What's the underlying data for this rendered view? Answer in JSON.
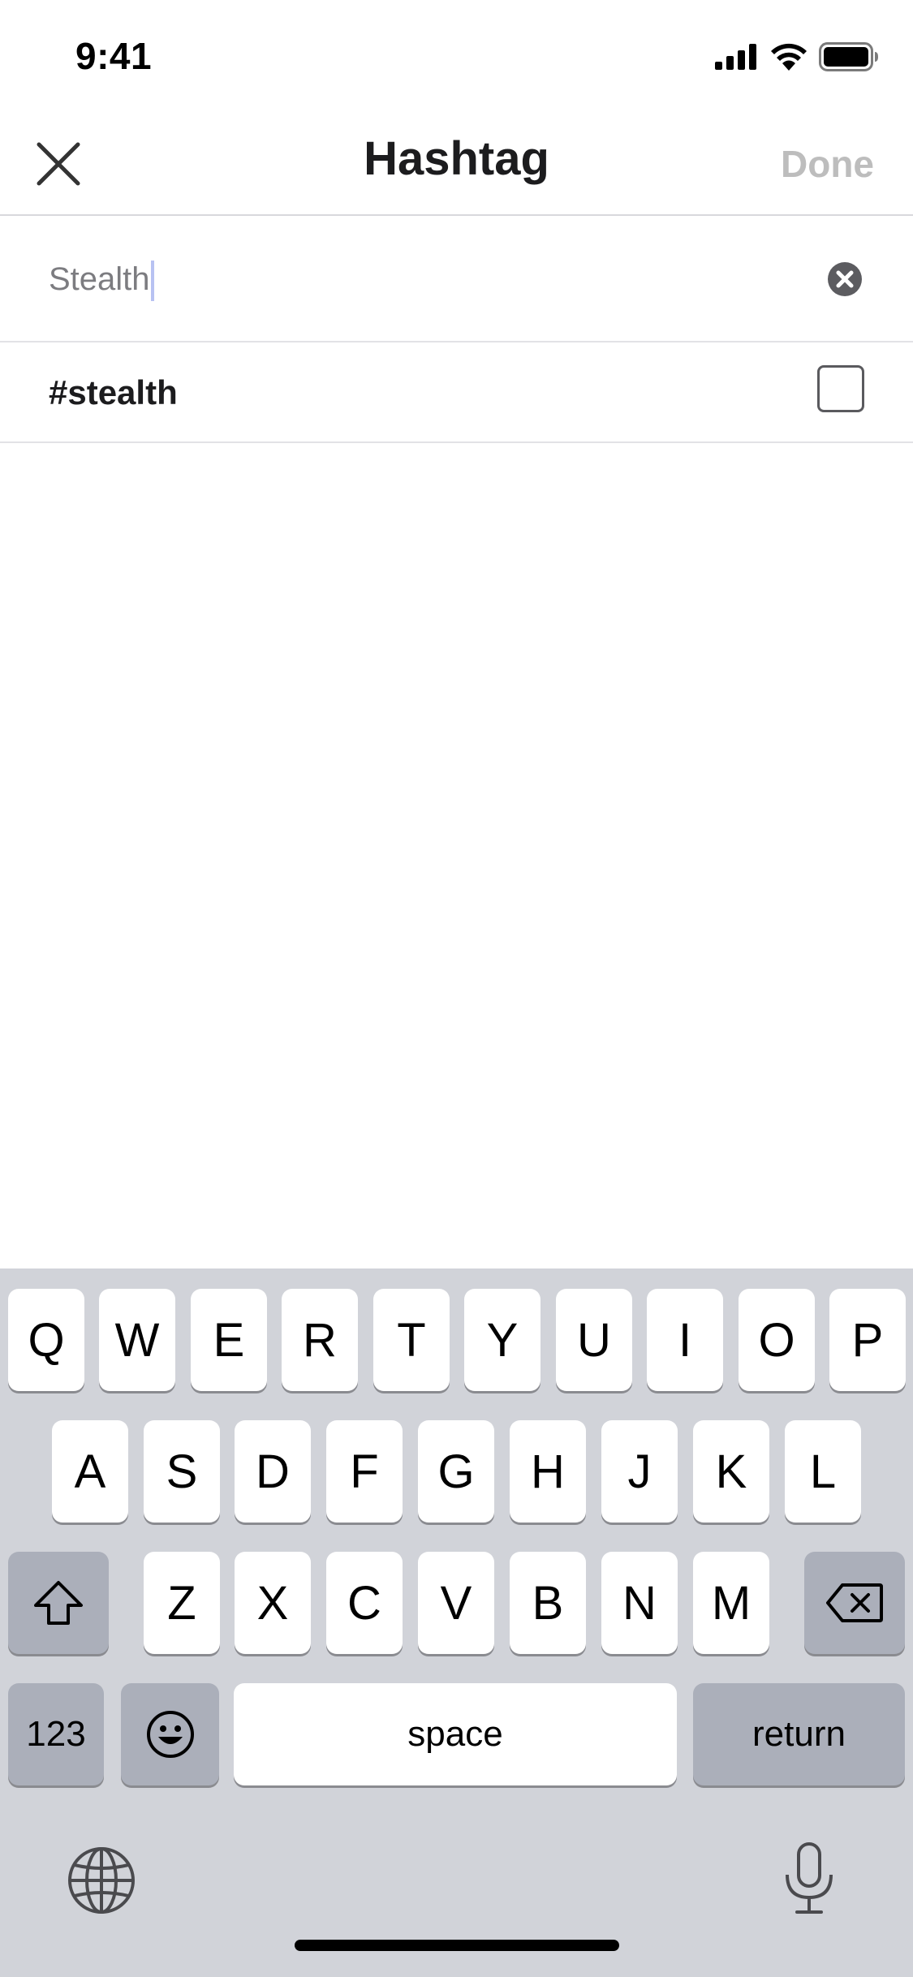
{
  "status_bar": {
    "time": "9:41"
  },
  "nav": {
    "title": "Hashtag",
    "done_label": "Done"
  },
  "search": {
    "value": "Stealth"
  },
  "results": [
    {
      "label": "#stealth",
      "checked": false
    }
  ],
  "keyboard": {
    "row1": [
      "Q",
      "W",
      "E",
      "R",
      "T",
      "Y",
      "U",
      "I",
      "O",
      "P"
    ],
    "row2": [
      "A",
      "S",
      "D",
      "F",
      "G",
      "H",
      "J",
      "K",
      "L"
    ],
    "row3": [
      "Z",
      "X",
      "C",
      "V",
      "B",
      "N",
      "M"
    ],
    "numbers_label": "123",
    "space_label": "space",
    "return_label": "return"
  },
  "icons": [
    "close-icon",
    "clear-icon",
    "signal-icon",
    "wifi-icon",
    "battery-icon",
    "shift-icon",
    "delete-icon",
    "emoji-icon",
    "globe-icon",
    "microphone-icon"
  ]
}
